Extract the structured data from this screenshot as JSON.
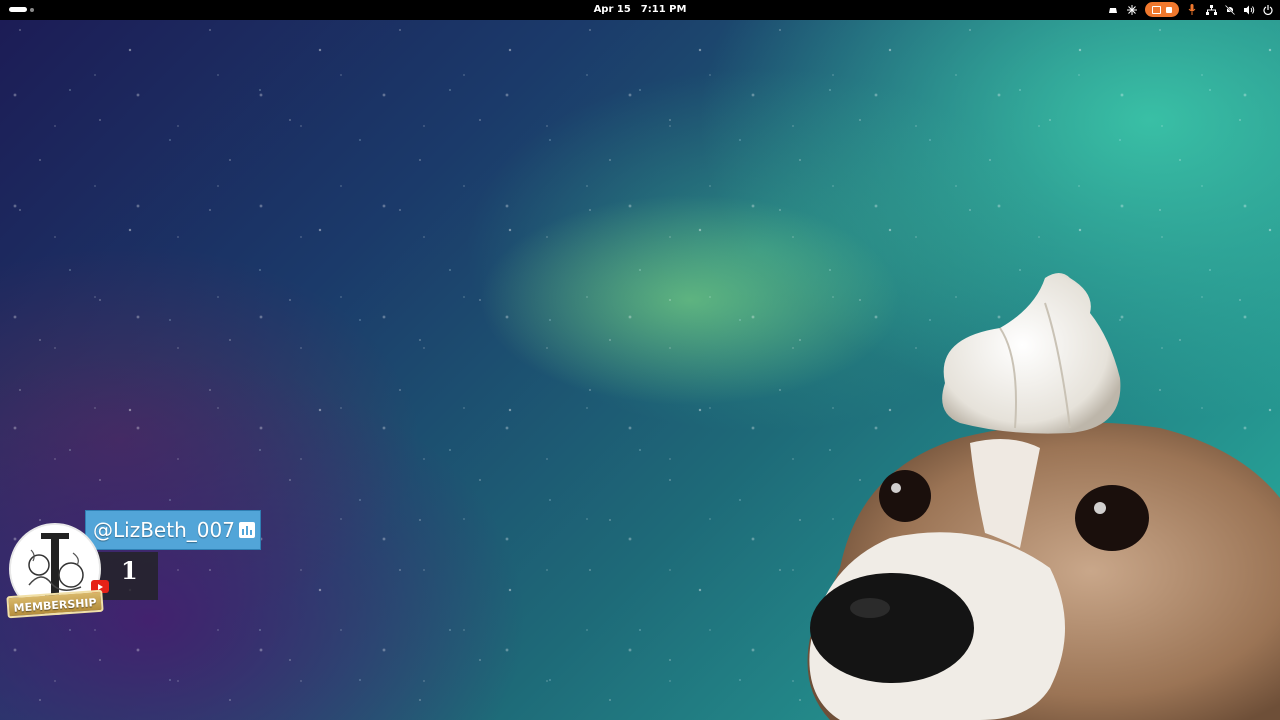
{
  "topbar": {
    "date": "Apr 15",
    "time": "7:11 PM",
    "tray_icons": [
      "ethernet-icon",
      "accessibility-icon",
      "screen-recording-indicator",
      "microphone-icon",
      "network-icon",
      "notifications-muted-icon",
      "volume-icon",
      "power-icon"
    ],
    "accent_color": "#f0782d"
  },
  "membership_widget": {
    "username": "@LizBeth_007",
    "count": "1",
    "badge_label": "MEMBERSHIP",
    "colors": {
      "username_bg": "#52a5d8",
      "badge_gold": "#c9a24e",
      "youtube_red": "#e62117"
    }
  },
  "wallpaper": {
    "description_icon": "space-nebula-wallpaper"
  }
}
